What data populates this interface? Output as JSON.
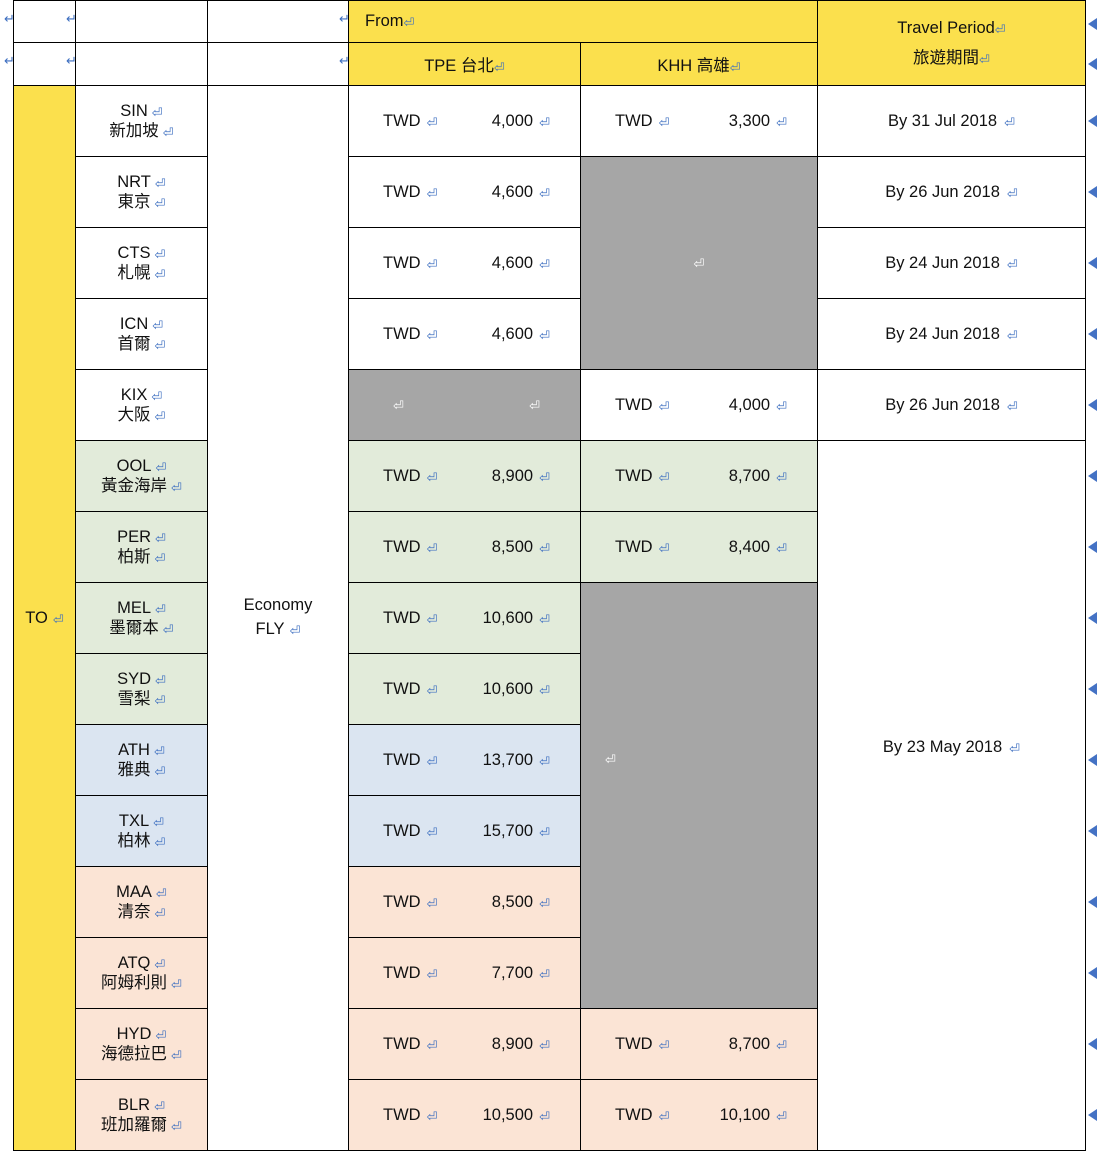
{
  "marks": {
    "paragraph": "⏎",
    "pilcrow_glyph": "↵"
  },
  "top_rows": [
    {
      "cells": [
        "↵",
        "↵",
        "",
        "↵",
        "↵"
      ]
    },
    {
      "cells": [
        "↵",
        "↵",
        "",
        "↵",
        "↵"
      ]
    }
  ],
  "header": {
    "from_label": "From",
    "from_mark": "↵",
    "travel_period_en": "Travel Period",
    "travel_period_en_mark": "↵",
    "travel_period_zh": "旅遊期間",
    "travel_period_zh_mark": "↵",
    "origins": [
      {
        "code": "TPE",
        "name": "台北",
        "mark": "↵"
      },
      {
        "code": "KHH",
        "name": "高雄",
        "mark": "↵"
      }
    ]
  },
  "side_label": {
    "text": "TO",
    "mark": "↵"
  },
  "cabin": {
    "line1": "Economy",
    "line2": "FLY",
    "mark": "↵"
  },
  "currency": "TWD",
  "colors": {
    "header_yellow": "#fbe04d",
    "row_white": "#ffffff",
    "row_green": "#e2ebda",
    "row_blue": "#dbe5f1",
    "row_peach": "#fbe4d5",
    "blocked_gray": "#a6a6a6",
    "mark_blue": "#3c6ec0",
    "row_end_marker": "#4472c4"
  },
  "travel_periods": [
    {
      "label": "By 31 Jul 2018",
      "mark": "↵"
    },
    {
      "label": "By 26 Jun 2018",
      "mark": "↵"
    },
    {
      "label": "By 24 Jun 2018",
      "mark": "↵"
    },
    {
      "label": "By 24 Jun 2018",
      "mark": "↵"
    },
    {
      "label": "By 26 Jun 2018",
      "mark": "↵"
    },
    {
      "label": "By 23 May 2018",
      "mark": "↵"
    }
  ],
  "rows": [
    {
      "code": "SIN",
      "name": "新加坡",
      "tint": "white",
      "tpe": {
        "currency": "TWD",
        "amount": "4,000",
        "blocked": false
      },
      "khh": {
        "currency": "TWD",
        "amount": "3,300",
        "blocked": false
      }
    },
    {
      "code": "NRT",
      "name": "東京",
      "tint": "white",
      "tpe": {
        "currency": "TWD",
        "amount": "4,600",
        "blocked": false
      },
      "khh": {
        "currency": "",
        "amount": "",
        "blocked": true
      }
    },
    {
      "code": "CTS",
      "name": "札幌",
      "tint": "white",
      "tpe": {
        "currency": "TWD",
        "amount": "4,600",
        "blocked": false
      },
      "khh": {
        "currency": "",
        "amount": "",
        "blocked": true
      }
    },
    {
      "code": "ICN",
      "name": "首爾",
      "tint": "white",
      "tpe": {
        "currency": "TWD",
        "amount": "4,600",
        "blocked": false
      },
      "khh": {
        "currency": "",
        "amount": "",
        "blocked": true
      }
    },
    {
      "code": "KIX",
      "name": "大阪",
      "tint": "white",
      "tpe": {
        "currency": "",
        "amount": "",
        "blocked": true
      },
      "khh": {
        "currency": "TWD",
        "amount": "4,000",
        "blocked": false
      }
    },
    {
      "code": "OOL",
      "name": "黃金海岸",
      "tint": "green",
      "tpe": {
        "currency": "TWD",
        "amount": "8,900",
        "blocked": false
      },
      "khh": {
        "currency": "TWD",
        "amount": "8,700",
        "blocked": false
      }
    },
    {
      "code": "PER",
      "name": "柏斯",
      "tint": "green",
      "tpe": {
        "currency": "TWD",
        "amount": "8,500",
        "blocked": false
      },
      "khh": {
        "currency": "TWD",
        "amount": "8,400",
        "blocked": false
      }
    },
    {
      "code": "MEL",
      "name": "墨爾本",
      "tint": "green",
      "tpe": {
        "currency": "TWD",
        "amount": "10,600",
        "blocked": false
      },
      "khh": {
        "currency": "",
        "amount": "",
        "blocked": true
      }
    },
    {
      "code": "SYD",
      "name": "雪梨",
      "tint": "green",
      "tpe": {
        "currency": "TWD",
        "amount": "10,600",
        "blocked": false
      },
      "khh": {
        "currency": "",
        "amount": "",
        "blocked": true
      }
    },
    {
      "code": "ATH",
      "name": "雅典",
      "tint": "blue",
      "tpe": {
        "currency": "TWD",
        "amount": "13,700",
        "blocked": false
      },
      "khh": {
        "currency": "",
        "amount": "",
        "blocked": true
      }
    },
    {
      "code": "TXL",
      "name": "柏林",
      "tint": "blue",
      "tpe": {
        "currency": "TWD",
        "amount": "15,700",
        "blocked": false
      },
      "khh": {
        "currency": "",
        "amount": "",
        "blocked": true
      }
    },
    {
      "code": "MAA",
      "name": "清奈",
      "tint": "peach",
      "tpe": {
        "currency": "TWD",
        "amount": "8,500",
        "blocked": false
      },
      "khh": {
        "currency": "",
        "amount": "",
        "blocked": true
      }
    },
    {
      "code": "ATQ",
      "name": "阿姆利則",
      "tint": "peach",
      "tpe": {
        "currency": "TWD",
        "amount": "7,700",
        "blocked": false
      },
      "khh": {
        "currency": "",
        "amount": "",
        "blocked": true
      }
    },
    {
      "code": "HYD",
      "name": "海德拉巴",
      "tint": "peach",
      "tpe": {
        "currency": "TWD",
        "amount": "8,900",
        "blocked": false
      },
      "khh": {
        "currency": "TWD",
        "amount": "8,700",
        "blocked": false
      }
    },
    {
      "code": "BLR",
      "name": "班加羅爾",
      "tint": "peach",
      "tpe": {
        "currency": "TWD",
        "amount": "10,500",
        "blocked": false
      },
      "khh": {
        "currency": "TWD",
        "amount": "10,100",
        "blocked": false
      }
    }
  ]
}
